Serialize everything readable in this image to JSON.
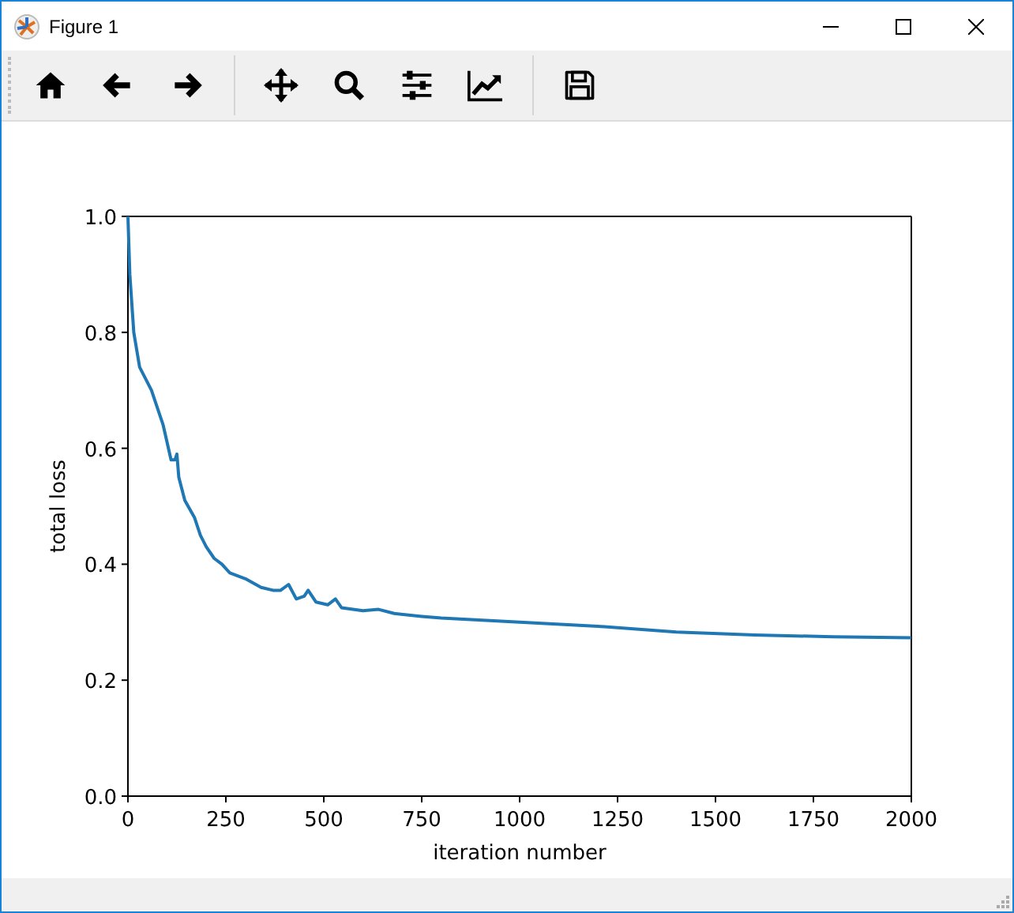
{
  "window": {
    "title": "Figure 1"
  },
  "plot": {
    "chart_data": {
      "type": "line",
      "xlabel": "iteration number",
      "ylabel": "total loss",
      "xlim": [
        0,
        2000
      ],
      "ylim": [
        0,
        1
      ],
      "xticks": [
        {
          "value": 0,
          "label": "0"
        },
        {
          "value": 250,
          "label": "250"
        },
        {
          "value": 500,
          "label": "500"
        },
        {
          "value": 750,
          "label": "750"
        },
        {
          "value": 1000,
          "label": "1000"
        },
        {
          "value": 1250,
          "label": "1250"
        },
        {
          "value": 1500,
          "label": "1500"
        },
        {
          "value": 1750,
          "label": "1750"
        },
        {
          "value": 2000,
          "label": "2000"
        }
      ],
      "yticks": [
        {
          "value": 0,
          "label": "0.0"
        },
        {
          "value": 0.2,
          "label": "0.2"
        },
        {
          "value": 0.4,
          "label": "0.4"
        },
        {
          "value": 0.6,
          "label": "0.6"
        },
        {
          "value": 0.8,
          "label": "0.8"
        },
        {
          "value": 1,
          "label": "1.0"
        }
      ],
      "x": [
        0,
        5,
        15,
        30,
        60,
        90,
        110,
        120,
        125,
        130,
        145,
        170,
        185,
        200,
        220,
        240,
        260,
        300,
        340,
        370,
        390,
        410,
        430,
        450,
        460,
        480,
        510,
        530,
        545,
        600,
        640,
        680,
        750,
        800,
        1000,
        1200,
        1400,
        1600,
        1800,
        2000
      ],
      "series": [
        {
          "color": "#1f77b4",
          "values": [
            1.0,
            0.9,
            0.8,
            0.74,
            0.7,
            0.64,
            0.58,
            0.58,
            0.59,
            0.55,
            0.51,
            0.48,
            0.45,
            0.43,
            0.41,
            0.4,
            0.385,
            0.375,
            0.36,
            0.355,
            0.355,
            0.365,
            0.34,
            0.345,
            0.355,
            0.335,
            0.33,
            0.34,
            0.325,
            0.32,
            0.322,
            0.315,
            0.31,
            0.307,
            0.3,
            0.293,
            0.283,
            0.278,
            0.275,
            0.273
          ]
        }
      ]
    }
  }
}
